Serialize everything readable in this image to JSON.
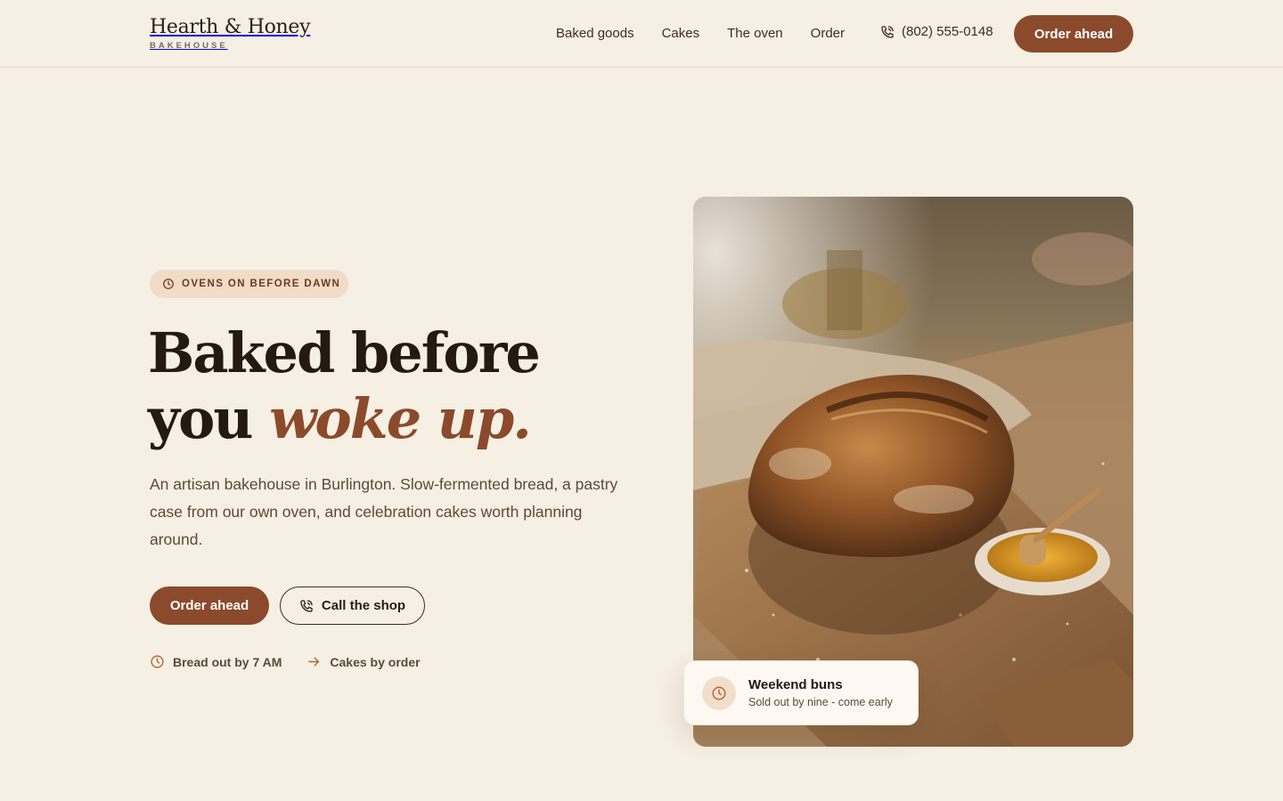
{
  "header": {
    "brand_name": "Hearth & Honey",
    "brand_sub": "BAKEHOUSE",
    "nav": [
      "Baked goods",
      "Cakes",
      "The oven",
      "Order"
    ],
    "phone": "(802) 555-0148",
    "cta": "Order ahead"
  },
  "hero": {
    "badge": "OVENS ON BEFORE DAWN",
    "headline_line1": "Baked before",
    "headline_line2_plain": "you",
    "headline_line2_accent": "woke up.",
    "lede": "An artisan bakehouse in Burlington. Slow-fermented bread, a pastry case from our own oven, and celebration cakes worth planning around.",
    "primary_cta": "Order ahead",
    "secondary_cta": "Call the shop",
    "meta": [
      {
        "icon": "clock-icon",
        "text": "Bread out by 7 AM"
      },
      {
        "icon": "arrow-right-icon",
        "text": "Cakes by order"
      }
    ]
  },
  "card": {
    "icon": "clock-icon",
    "title": "Weekend buns",
    "subtitle": "Sold out by nine - come early"
  },
  "colors": {
    "background": "#f6efe3",
    "accent": "#8b4a2b",
    "badge_bg": "#f0dcc8",
    "text": "#2b2016"
  }
}
